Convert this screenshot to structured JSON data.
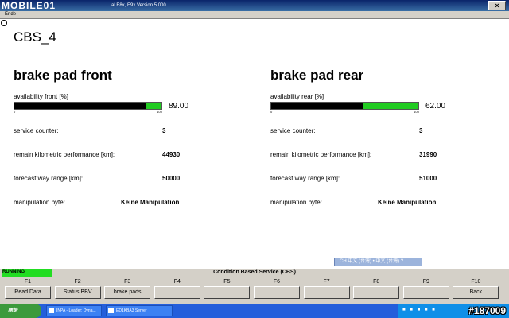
{
  "window": {
    "logo_text": "MOBILE01",
    "title_fragment": "al E8x, E9x Version 5.000"
  },
  "menubar": {
    "item": "Ende"
  },
  "screen": {
    "title": "CBS_4"
  },
  "front": {
    "title": "brake pad front",
    "availability_label": "availability front [%]",
    "availability_value": "89.00",
    "availability_fraction": 0.89,
    "scale_min": "0",
    "scale_max": "100",
    "rows": [
      {
        "label": "service counter:",
        "value": "3"
      },
      {
        "label": "remain kilometric performance [km]:",
        "value": "44930"
      },
      {
        "label": "forecast way range [km]:",
        "value": "50000"
      },
      {
        "label": "manipulation byte:",
        "value": "Keine Manipulation"
      }
    ]
  },
  "rear": {
    "title": "brake pad rear",
    "availability_label": "availability rear [%]",
    "availability_value": "62.00",
    "availability_fraction": 0.62,
    "scale_min": "0",
    "scale_max": "100",
    "rows": [
      {
        "label": "service counter:",
        "value": "3"
      },
      {
        "label": "remain kilometric performance [km]:",
        "value": "31990"
      },
      {
        "label": "forecast way range [km]:",
        "value": "51000"
      },
      {
        "label": "manipulation byte:",
        "value": "Keine Manipulation"
      }
    ]
  },
  "language_bar": {
    "text": "CH 中文 (台灣) • 中文 (台灣) ?"
  },
  "status": {
    "running": "RUNNING",
    "title": "Condition Based Service (CBS)"
  },
  "fkeys": [
    {
      "key": "F1",
      "label": "Read Data"
    },
    {
      "key": "F2",
      "label": "Status BBV"
    },
    {
      "key": "F3",
      "label": "brake pads"
    },
    {
      "key": "F4",
      "label": ""
    },
    {
      "key": "F5",
      "label": ""
    },
    {
      "key": "F6",
      "label": ""
    },
    {
      "key": "F7",
      "label": ""
    },
    {
      "key": "F8",
      "label": ""
    },
    {
      "key": "F9",
      "label": ""
    },
    {
      "key": "F10",
      "label": "Back"
    }
  ],
  "taskbar": {
    "start_label": "開始",
    "tasks": [
      "INPA - Loader: Dyna...",
      "ED1KBA3 Server"
    ],
    "watermark": "#187009"
  },
  "colors": {
    "bar_green": "#22cc22",
    "running_green": "#22dd22",
    "taskbar_blue": "#245edb"
  }
}
